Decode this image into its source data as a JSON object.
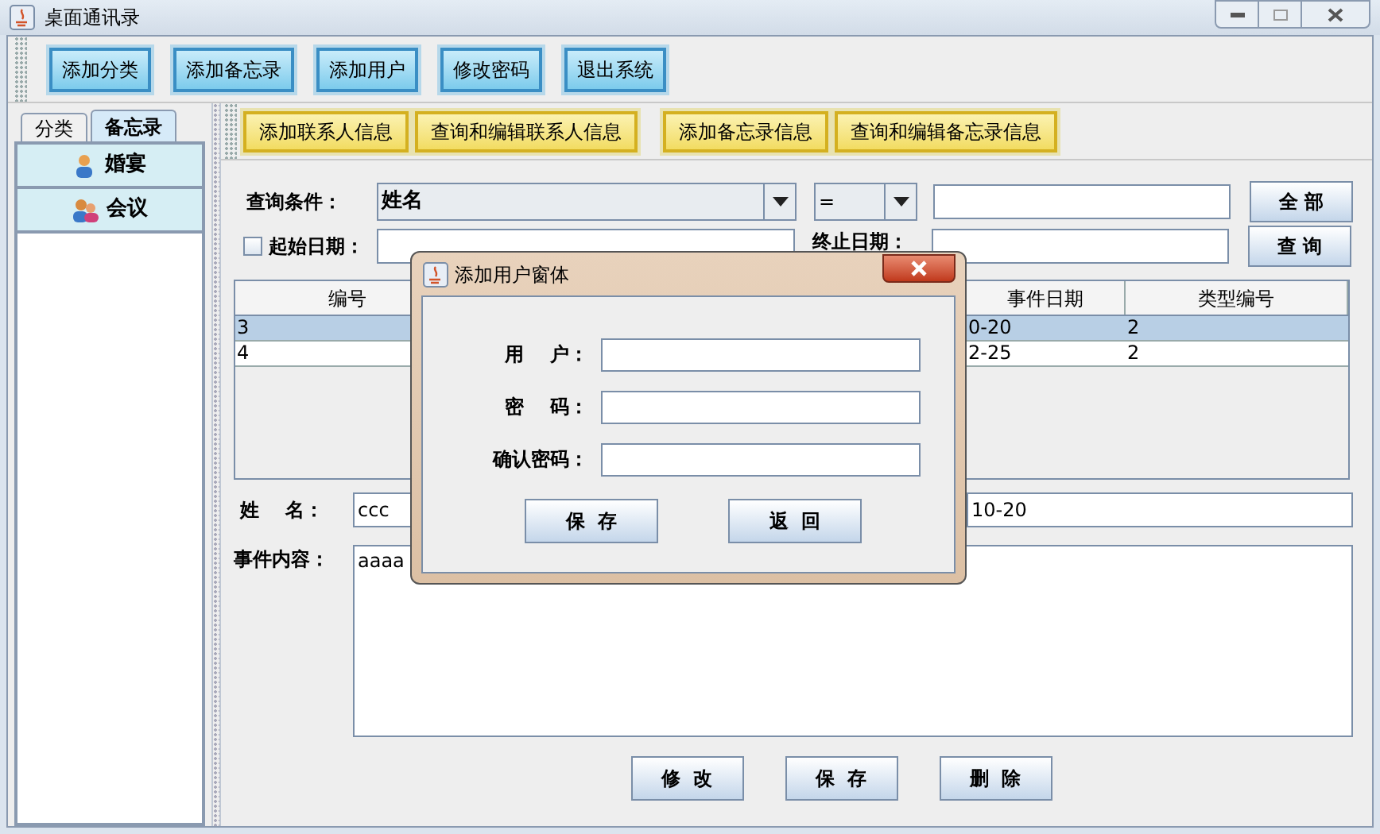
{
  "window": {
    "title": "桌面通讯录"
  },
  "toolbar": [
    "添加分类",
    "添加备忘录",
    "添加用户",
    "修改密码",
    "退出系统"
  ],
  "side_tabs": [
    {
      "label": "分类",
      "selected": false
    },
    {
      "label": "备忘录",
      "selected": true
    }
  ],
  "categories": [
    {
      "label": "婚宴",
      "kind": "person"
    },
    {
      "label": "会议",
      "kind": "group"
    }
  ],
  "action_bar": [
    "添加联系人信息",
    "查询和编辑联系人信息",
    "添加备忘录信息",
    "查询和编辑备忘录信息"
  ],
  "query": {
    "label": "查询条件：",
    "field": "姓名",
    "operator": "=",
    "all_button": "全 部",
    "search_button": "查 询"
  },
  "start_date": {
    "label": "起始日期：",
    "checked": false
  },
  "end_date": {
    "label": "终止日期："
  },
  "table": {
    "columns": [
      "编号",
      "事件日期",
      "类型编号"
    ],
    "rows": [
      {
        "cells": [
          "3",
          "0-20",
          "2"
        ],
        "selected": true
      },
      {
        "cells": [
          "4",
          "2-25",
          "2"
        ],
        "selected": false
      }
    ]
  },
  "detail": {
    "name_label": "姓    名：",
    "name": "ccc",
    "date": "10-20",
    "content_label": "事件内容：",
    "content": "aaaa"
  },
  "buttons": [
    "修  改",
    "保  存",
    "删  除"
  ],
  "dialog": {
    "title": "添加用户窗体",
    "fields": [
      "用    户：",
      "密    码：",
      "确认密码："
    ],
    "buttons": [
      "保  存",
      "返  回"
    ]
  }
}
